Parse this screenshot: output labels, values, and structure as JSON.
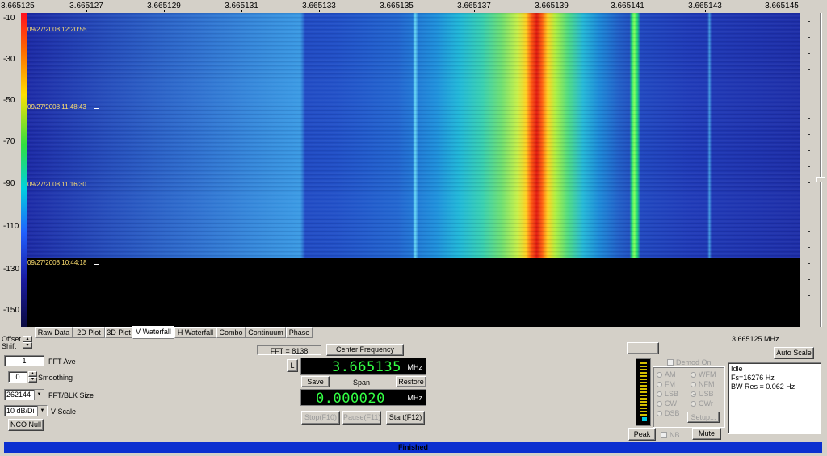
{
  "colors": {
    "window_bg": "#d4d0c8",
    "waterfall_bg": "#1a2fb0",
    "signal_core": "#e21a10",
    "signal_halo": "#22d84a",
    "status_bar": "#0b2fd0",
    "led_text": "#33ff44"
  },
  "x_axis": {
    "ticks": [
      "3.665125",
      "3.665127",
      "3.665129",
      "3.665131",
      "3.665133",
      "3.665135",
      "3.665137",
      "3.665139",
      "3.665141",
      "3.665143",
      "3.665145"
    ]
  },
  "y_axis": {
    "ticks": [
      "-10",
      "-30",
      "-50",
      "-70",
      "-90",
      "-110",
      "-130",
      "-150"
    ]
  },
  "waterfall": {
    "timestamps": [
      "09/27/2008 12:20:55",
      "09/27/2008 11:48:43",
      "09/27/2008 11:16:30",
      "09/27/2008 10:44:18"
    ],
    "color_scale": "rainbow"
  },
  "tabs": [
    {
      "label": "Raw Data",
      "active": false
    },
    {
      "label": "2D Plot",
      "active": false
    },
    {
      "label": "3D Plot",
      "active": false
    },
    {
      "label": "V Waterfall",
      "active": true
    },
    {
      "label": "H Waterfall",
      "active": false
    },
    {
      "label": "Combo",
      "active": false
    },
    {
      "label": "Continuum",
      "active": false
    },
    {
      "label": "Phase",
      "active": false
    }
  ],
  "left_controls": {
    "offset_shift_label_1": "Offset",
    "offset_shift_label_2": "Shift",
    "fft_ave_value": "1",
    "fft_ave_label": "FFT Ave",
    "smoothing_value": "0",
    "smoothing_label": "Smoothing",
    "fft_blk_value": "262144",
    "fft_blk_label": "FFT/BLK Size",
    "vscale_value": "10 dB/Di",
    "vscale_label": "V Scale",
    "nco_null_label": "NCO Null"
  },
  "center_controls": {
    "fft_readout": "FFT = 8138",
    "center_freq_button": "Center Frequency",
    "l_button": "L",
    "center_freq_value": "3.665135",
    "center_freq_unit": "MHz",
    "save_button": "Save",
    "span_label": "Span",
    "restore_button": "Restore",
    "span_value": "0.000020",
    "span_unit": "MHz",
    "stop_button": "Stop(F10)",
    "pause_button": "Pause(F11)",
    "start_button": "Start(F12)"
  },
  "right_controls": {
    "freq_readout": "3.665125 MHz",
    "auto_scale_button": "Auto Scale",
    "demod_on_label": "Demod On",
    "modes_col1": [
      "AM",
      "FM",
      "LSB",
      "CW",
      "DSB"
    ],
    "modes_col2": [
      "WFM",
      "NFM",
      "USB",
      "CWr"
    ],
    "selected_mode": "USB",
    "setup_button": "Setup...",
    "peak_button": "Peak",
    "nb_label": "NB",
    "mute_button": "Mute",
    "status_lines": [
      "Idle",
      "Fs=16276 Hz",
      "BW Res = 0.062 Hz"
    ],
    "signal_meter_level": 0.04
  },
  "status_bar": {
    "text": "Finished"
  }
}
